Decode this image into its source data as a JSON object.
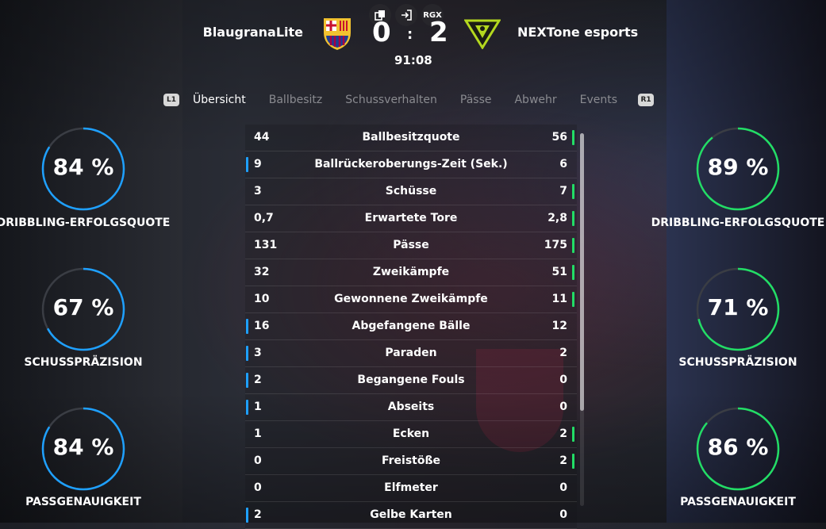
{
  "header": {
    "icons": [
      "copy-icon",
      "exit-icon"
    ],
    "rgx_label": "RGX",
    "home_team": "BlaugranaLite",
    "away_team": "NEXTone esports",
    "home_score": "0",
    "separator": ":",
    "away_score": "2",
    "clock": "91:08"
  },
  "tabs": {
    "left_button": "L1",
    "right_button": "R1",
    "items": [
      "Übersicht",
      "Ballbesitz",
      "Schussverhalten",
      "Pässe",
      "Abwehr",
      "Events"
    ],
    "active": "Übersicht"
  },
  "home_rings": [
    {
      "value": "84 %",
      "label": "DRIBBLING-ERFOLGSQUOTE",
      "fraction": 0.84
    },
    {
      "value": "67 %",
      "label": "SCHUSSPRÄZISION",
      "fraction": 0.67
    },
    {
      "value": "84 %",
      "label": "PASSGENAUIGKEIT",
      "fraction": 0.84
    }
  ],
  "away_rings": [
    {
      "value": "89 %",
      "label": "DRIBBLING-ERFOLGSQUOTE",
      "fraction": 0.89
    },
    {
      "value": "71 %",
      "label": "SCHUSSPRÄZISION",
      "fraction": 0.71
    },
    {
      "value": "86 %",
      "label": "PASSGENAUIGKEIT",
      "fraction": 0.86
    }
  ],
  "colors": {
    "home": "#1ea0ff",
    "away": "#22dd66",
    "ring_track": "#3a3d44"
  },
  "stats": [
    {
      "home": "44",
      "label": "Ballbesitzquote",
      "away": "56",
      "leader": "away"
    },
    {
      "home": "9",
      "label": "Ballrückeroberungs-Zeit (Sek.)",
      "away": "6",
      "leader": "home"
    },
    {
      "home": "3",
      "label": "Schüsse",
      "away": "7",
      "leader": "away"
    },
    {
      "home": "0,7",
      "label": "Erwartete Tore",
      "away": "2,8",
      "leader": "away"
    },
    {
      "home": "131",
      "label": "Pässe",
      "away": "175",
      "leader": "away"
    },
    {
      "home": "32",
      "label": "Zweikämpfe",
      "away": "51",
      "leader": "away"
    },
    {
      "home": "10",
      "label": "Gewonnene Zweikämpfe",
      "away": "11",
      "leader": "away"
    },
    {
      "home": "16",
      "label": "Abgefangene Bälle",
      "away": "12",
      "leader": "home"
    },
    {
      "home": "3",
      "label": "Paraden",
      "away": "2",
      "leader": "home"
    },
    {
      "home": "2",
      "label": "Begangene Fouls",
      "away": "0",
      "leader": "home"
    },
    {
      "home": "1",
      "label": "Abseits",
      "away": "0",
      "leader": "home"
    },
    {
      "home": "1",
      "label": "Ecken",
      "away": "2",
      "leader": "away"
    },
    {
      "home": "0",
      "label": "Freistöße",
      "away": "2",
      "leader": "away"
    },
    {
      "home": "0",
      "label": "Elfmeter",
      "away": "0",
      "leader": "none"
    },
    {
      "home": "2",
      "label": "Gelbe Karten",
      "away": "0",
      "leader": "home"
    }
  ]
}
